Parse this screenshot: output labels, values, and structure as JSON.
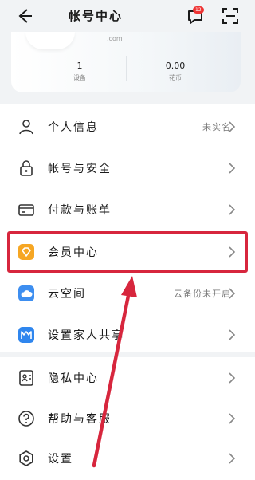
{
  "header": {
    "title": "帐号中心",
    "message_badge": "12",
    "icons": [
      "back-icon",
      "message-icon",
      "scan-icon"
    ]
  },
  "account": {
    "email_suffix": ".com",
    "stats": [
      {
        "value": "1",
        "label": "设备"
      },
      {
        "value": "0.00",
        "label": "花币"
      }
    ]
  },
  "menu": {
    "group1": [
      {
        "label": "个人信息",
        "value": "未实名",
        "icon": "person-icon"
      },
      {
        "label": "帐号与安全",
        "value": "",
        "icon": "lock-icon"
      },
      {
        "label": "付款与账单",
        "value": "",
        "icon": "card-icon"
      },
      {
        "label": "会员中心",
        "value": "",
        "icon": "vip-diamond-icon"
      },
      {
        "label": "云空间",
        "value": "云备份未开启",
        "icon": "cloud-icon"
      },
      {
        "label": "设置家人共享",
        "value": "",
        "icon": "family-share-icon"
      }
    ],
    "group2": [
      {
        "label": "隐私中心",
        "value": "",
        "icon": "privacy-icon"
      },
      {
        "label": "帮助与客服",
        "value": "",
        "icon": "help-icon"
      },
      {
        "label": "设置",
        "value": "",
        "icon": "settings-icon"
      }
    ]
  },
  "annotation": {
    "highlight_color": "#d7263d"
  }
}
